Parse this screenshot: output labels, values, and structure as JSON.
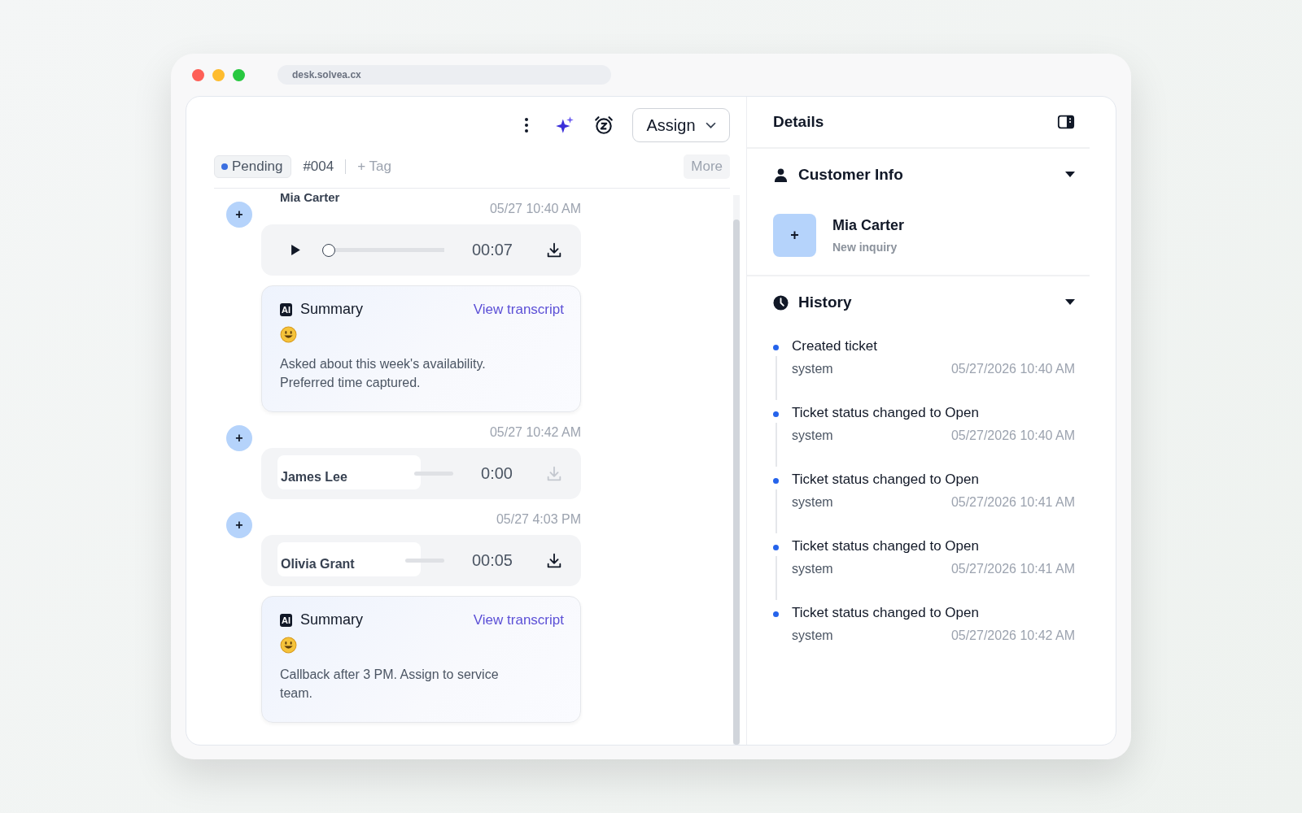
{
  "browser": {
    "url": "desk.solvea.cx"
  },
  "toolbar": {
    "assign_button": "Assign"
  },
  "ticket": {
    "status": "Pending",
    "number": "#004",
    "add_tag": "+ Tag",
    "more_button": "More"
  },
  "conversation": [
    {
      "kind": "player",
      "avatar": "+",
      "name": "Mia Carter",
      "time": "05/27 10:40 AM",
      "duration": "00:07",
      "level": 0,
      "download_disabled": false,
      "summary": {
        "badge": "AI",
        "title": "Summary",
        "link": "View transcript",
        "text": "Asked about this week's availability. Preferred time captured."
      }
    },
    {
      "kind": "overlaid",
      "avatar": "+",
      "name": "James Lee",
      "time": "05/27 10:42 AM",
      "duration": "0:00",
      "download_disabled": true
    },
    {
      "kind": "overlaid",
      "avatar": "+",
      "name": "Olivia Grant",
      "time": "05/27 4:03 PM",
      "duration": "00:05",
      "download_disabled": false,
      "summary": {
        "badge": "AI",
        "title": "Summary",
        "link": "View transcript",
        "text": "Callback after 3 PM. Assign to service team."
      }
    }
  ],
  "details": {
    "title": "Details",
    "customer_info": {
      "heading": "Customer Info",
      "expanded": true,
      "avatar": "+",
      "name": "Mia Carter",
      "note": "New inquiry"
    },
    "history": {
      "heading": "History",
      "expanded": true,
      "items": [
        {
          "event": "Created ticket",
          "actor": "system",
          "time": "05/27/2026 10:40 AM"
        },
        {
          "event": "Ticket status changed to Open",
          "actor": "system",
          "time": "05/27/2026 10:40 AM"
        },
        {
          "event": "Ticket status changed to Open",
          "actor": "system",
          "time": "05/27/2026 10:41 AM"
        },
        {
          "event": "Ticket status changed to Open",
          "actor": "system",
          "time": "05/27/2026 10:41 AM"
        },
        {
          "event": "Ticket status changed to Open",
          "actor": "system",
          "time": "05/27/2026 10:42 AM"
        }
      ]
    }
  }
}
